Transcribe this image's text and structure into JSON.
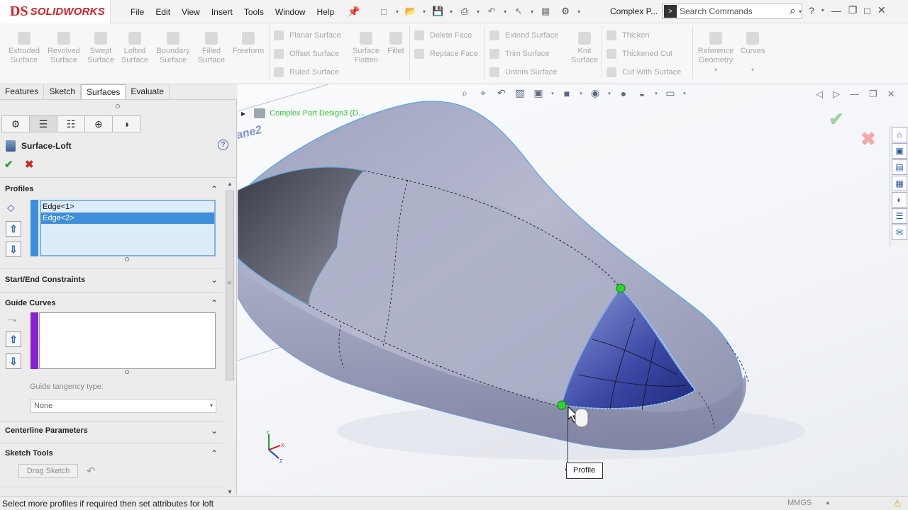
{
  "app": {
    "brand_glyph": "DS",
    "brand": "SOLIDWORKS"
  },
  "menu": [
    "File",
    "Edit",
    "View",
    "Insert",
    "Tools",
    "Window",
    "Help"
  ],
  "document_title": "Complex P...",
  "search": {
    "placeholder": "Search Commands"
  },
  "ribbon": {
    "large": [
      {
        "label": "Extruded\nSurface"
      },
      {
        "label": "Revolved\nSurface"
      },
      {
        "label": "Swept\nSurface"
      },
      {
        "label": "Lofted\nSurface"
      },
      {
        "label": "Boundary\nSurface"
      },
      {
        "label": "Filled\nSurface"
      },
      {
        "label": "Freeform"
      }
    ],
    "col1": [
      "Planar Surface",
      "Offset Surface",
      "Ruled Surface"
    ],
    "surface_flatten": "Surface\nFlatten",
    "fillet": "Fillet",
    "col2": [
      "Delete Face",
      "Replace Face"
    ],
    "col3": [
      "Extend Surface",
      "Trim Surface",
      "Untrim Surface"
    ],
    "knit": "Knit\nSurface",
    "col4": [
      "Thicken",
      "Thickened Cut",
      "Cut With Surface"
    ],
    "reference_geometry": "Reference\nGeometry",
    "curves": "Curves"
  },
  "tabs": [
    {
      "label": "Features",
      "active": false
    },
    {
      "label": "Sketch",
      "active": false
    },
    {
      "label": "Surfaces",
      "active": true
    },
    {
      "label": "Evaluate",
      "active": false
    }
  ],
  "property_manager": {
    "title": "Surface-Loft",
    "help": "?",
    "groups": {
      "profiles": {
        "title": "Profiles",
        "items": [
          {
            "label": "Edge<1>",
            "selected": false
          },
          {
            "label": "Edge<2>",
            "selected": true
          }
        ],
        "color": "#3c8fe0"
      },
      "start_end": {
        "title": "Start/End Constraints"
      },
      "guide_curves": {
        "title": "Guide Curves",
        "items": [],
        "color": "#8a1fd6",
        "tangency_label": "Guide tangency type:",
        "tangency_value": "None"
      },
      "centerline": {
        "title": "Centerline Parameters"
      },
      "sketch_tools": {
        "title": "Sketch Tools",
        "drag_label": "Drag Sketch"
      }
    }
  },
  "graphics": {
    "tree_item": "Complex Part Design3 (D...",
    "plane_label": "ane2",
    "callout": "Profile"
  },
  "status": {
    "message": "Select more profiles if required then set attributes for loft",
    "units": "MMGS"
  }
}
